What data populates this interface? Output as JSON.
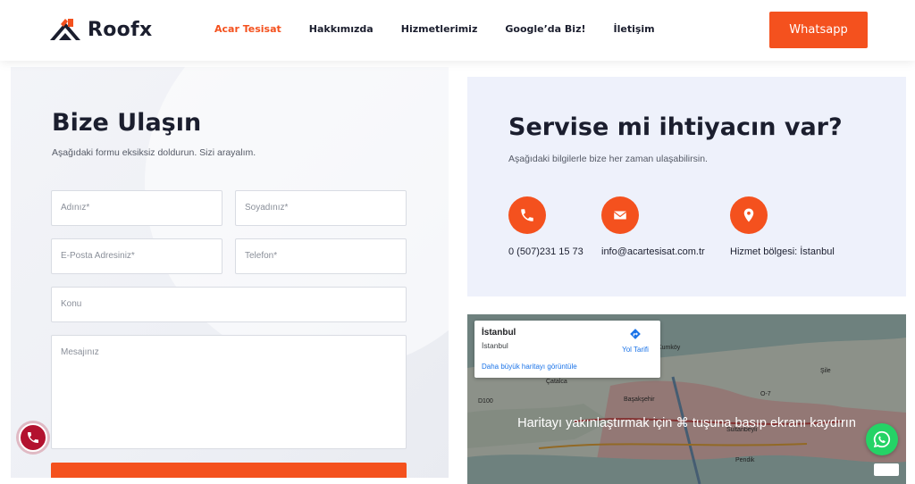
{
  "header": {
    "brand": "Roofx",
    "nav": [
      "Acar Tesisat",
      "Hakkımızda",
      "Hizmetlerimiz",
      "Google’da Biz!",
      "İletişim"
    ],
    "cta": "Whatsapp",
    "accent_color": "#f4511e"
  },
  "form": {
    "title": "Bize Ulaşın",
    "subtitle": "Aşağıdaki formu eksiksiz doldurun. Sizi arayalım.",
    "first_name": "Adınız*",
    "last_name": "Soyadınız*",
    "email": "E-Posta Adresiniz*",
    "phone": "Telefon*",
    "subject": "Konu",
    "message": "Mesajınız"
  },
  "info": {
    "title": "Servise mi ihtiyacın var?",
    "subtitle": "Aşağıdaki bilgilerle bize her zaman ulaşabilirsin.",
    "phone": "0 (507)231 15 73",
    "email": "info@acartesisat.com.tr",
    "region": "Hizmet bölgesi: İstanbul",
    "icons": [
      "phone-icon",
      "envelope-icon",
      "location-pin-icon"
    ]
  },
  "map": {
    "place_title": "İstanbul",
    "place_sub": "İstanbul",
    "directions": "Yol Tarifi",
    "larger_map": "Daha büyük haritayı görüntüle",
    "scroll_hint": "Haritayı yakınlaştırmak için ⌘ tuşuna basıp ekranı kaydırın",
    "labels": [
      "Kumköy",
      "Şile",
      "Çatalca",
      "Başakşehir",
      "Sultanbeyli",
      "Pendik",
      "D100",
      "O-7"
    ]
  }
}
